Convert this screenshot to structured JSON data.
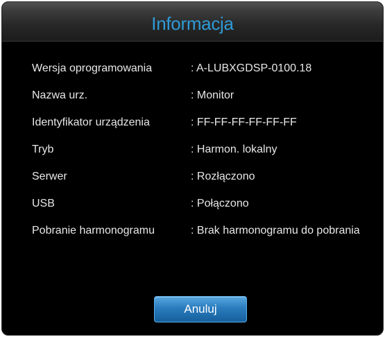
{
  "dialog": {
    "title": "Informacja",
    "rows": [
      {
        "label": "Wersja oprogramowania",
        "value": ": A-LUBXGDSP-0100.18"
      },
      {
        "label": "Nazwa urz.",
        "value": ": Monitor"
      },
      {
        "label": "Identyfikator urządzenia",
        "value": ": FF-FF-FF-FF-FF-FF"
      },
      {
        "label": "Tryb",
        "value": ": Harmon. lokalny"
      },
      {
        "label": "Serwer",
        "value": ": Rozłączono"
      },
      {
        "label": "USB",
        "value": ": Połączono"
      },
      {
        "label": "Pobranie harmonogramu",
        "value": ": Brak harmonogramu do pobrania"
      }
    ],
    "cancel_label": "Anuluj"
  },
  "colors": {
    "title": "#2f9ad6",
    "background": "#000000",
    "text": "#e8e8e8",
    "button": "#2a7cbe"
  }
}
